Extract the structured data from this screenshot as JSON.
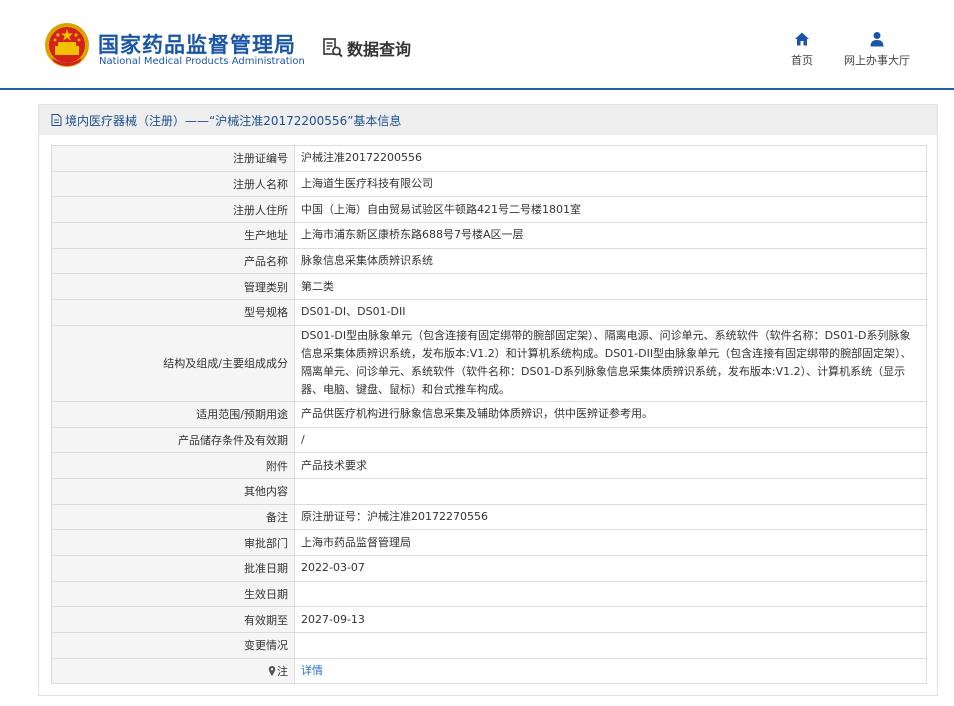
{
  "header": {
    "brand_cn": "国家药品监督管理局",
    "brand_en": "National Medical Products Administration",
    "query_label": "数据查询",
    "nav": [
      {
        "label": "首页",
        "icon": "home-icon"
      },
      {
        "label": "网上办事大厅",
        "icon": "user-icon"
      }
    ]
  },
  "panel": {
    "title": "境内医疗器械（注册）——“沪械注准20172200556”基本信息"
  },
  "rows": [
    {
      "label": "注册证编号",
      "value": "沪械注准20172200556"
    },
    {
      "label": "注册人名称",
      "value": "上海道生医疗科技有限公司"
    },
    {
      "label": "注册人住所",
      "value": "中国（上海）自由贸易试验区牛顿路421号二号楼1801室"
    },
    {
      "label": "生产地址",
      "value": "上海市浦东新区康桥东路688号7号楼A区一层"
    },
    {
      "label": "产品名称",
      "value": "脉象信息采集体质辨识系统"
    },
    {
      "label": "管理类别",
      "value": "第二类"
    },
    {
      "label": "型号规格",
      "value": "DS01-DI、DS01-DII"
    },
    {
      "label": "结构及组成/主要组成成分",
      "value": "DS01-DI型由脉象单元（包含连接有固定绑带的腕部固定架）、隔离电源、问诊单元、系统软件（软件名称：DS01-D系列脉象信息采集体质辨识系统，发布版本:V1.2）和计算机系统构成。DS01-DII型由脉象单元（包含连接有固定绑带的腕部固定架）、隔离单元、问诊单元、系统软件（软件名称：DS01-D系列脉象信息采集体质辨识系统，发布版本:V1.2）、计算机系统（显示器、电脑、键盘、鼠标）和台式推车构成。"
    },
    {
      "label": "适用范围/预期用途",
      "value": "产品供医疗机构进行脉象信息采集及辅助体质辨识，供中医辨证参考用。"
    },
    {
      "label": "产品储存条件及有效期",
      "value": "/"
    },
    {
      "label": "附件",
      "value": "产品技术要求"
    },
    {
      "label": "其他内容",
      "value": ""
    },
    {
      "label": "备注",
      "value": "原注册证号：沪械注准20172270556"
    },
    {
      "label": "审批部门",
      "value": "上海市药品监督管理局"
    },
    {
      "label": "批准日期",
      "value": "2022-03-07"
    },
    {
      "label": "生效日期",
      "value": ""
    },
    {
      "label": "有效期至",
      "value": "2027-09-13"
    },
    {
      "label": "变更情况",
      "value": ""
    },
    {
      "label": "注",
      "value": "详情",
      "icon": "pin-icon"
    }
  ],
  "colors": {
    "brand_blue": "#1a56a7",
    "link_blue": "#2a73c8",
    "header_line": "#1e5fae"
  }
}
